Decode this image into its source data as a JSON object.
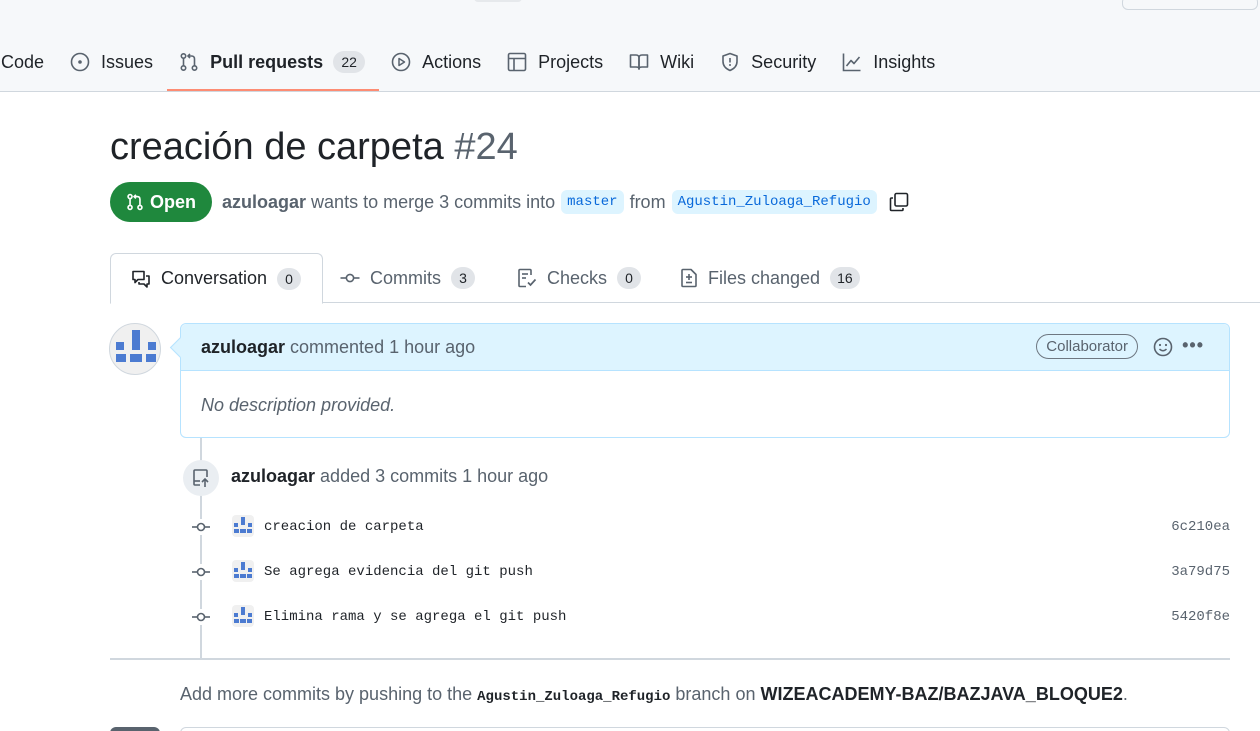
{
  "repo_nav": {
    "items": [
      {
        "label": "Code",
        "icon": "code-icon"
      },
      {
        "label": "Issues",
        "icon": "issue-opened-icon"
      },
      {
        "label": "Pull requests",
        "icon": "git-pull-request-icon",
        "count": "22",
        "selected": true
      },
      {
        "label": "Actions",
        "icon": "play-icon"
      },
      {
        "label": "Projects",
        "icon": "table-icon"
      },
      {
        "label": "Wiki",
        "icon": "book-icon"
      },
      {
        "label": "Security",
        "icon": "shield-icon"
      },
      {
        "label": "Insights",
        "icon": "graph-icon"
      }
    ]
  },
  "pr": {
    "title": "creación de carpeta",
    "number": "#24",
    "state": "Open",
    "author": "azuloagar",
    "merge_text": "wants to merge 3 commits into",
    "base_branch": "master",
    "from_text": "from",
    "head_branch": "Agustin_Zuloaga_Refugio"
  },
  "tabs": [
    {
      "label": "Conversation",
      "count": "0",
      "icon": "comment-discussion-icon",
      "selected": true
    },
    {
      "label": "Commits",
      "count": "3",
      "icon": "git-commit-icon"
    },
    {
      "label": "Checks",
      "count": "0",
      "icon": "checklist-icon"
    },
    {
      "label": "Files changed",
      "count": "16",
      "icon": "file-diff-icon"
    }
  ],
  "comment": {
    "author": "azuloagar",
    "action": "commented",
    "time": "1 hour ago",
    "role_badge": "Collaborator",
    "body": "No description provided."
  },
  "event": {
    "author": "azuloagar",
    "text": "added 3 commits 1 hour ago"
  },
  "commits": [
    {
      "message": "creacion de carpeta",
      "sha": "6c210ea"
    },
    {
      "message": "Se agrega evidencia del git push",
      "sha": "3a79d75"
    },
    {
      "message": "Elimina rama y se agrega el git push",
      "sha": "5420f8e"
    }
  ],
  "footer": {
    "prefix": "Add more commits by pushing to the",
    "branch": "Agustin_Zuloaga_Refugio",
    "middle": "branch on",
    "repo": "WIZEACADEMY-BAZ/BAZJAVA_BLOQUE2",
    "suffix": "."
  },
  "colors": {
    "accent": "#0969da",
    "open_green": "#1f883d",
    "tab_underline": "#fd8c73",
    "comment_header_bg": "#ddf4ff"
  }
}
